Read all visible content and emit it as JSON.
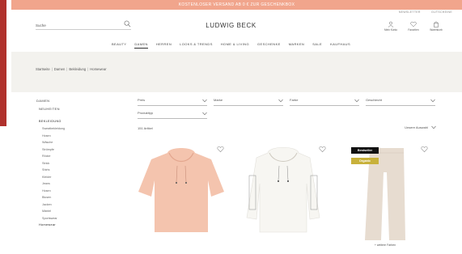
{
  "promo": {
    "text": "KOSTENLOSER VERSAND AB 0 € ZUR GESCHENKBOX"
  },
  "utility": {
    "link1": "NEWSLETTER",
    "link2": "GUTSCHEINE"
  },
  "search": {
    "placeholder": "Suche"
  },
  "header": {
    "logo": "LUDWIG BECK"
  },
  "account": {
    "items": [
      {
        "label": "Mein Konto",
        "icon": "user-icon"
      },
      {
        "label": "Favoriten",
        "icon": "heart-icon"
      },
      {
        "label": "Warenkorb",
        "icon": "bag-icon"
      }
    ]
  },
  "nav": {
    "items": [
      "BEAUTY",
      "DAMEN",
      "HERREN",
      "LOOKS & TRENDS",
      "HOME & LIVING",
      "GESCHENKE",
      "MARKEN",
      "SALE",
      "KAUFHAUS"
    ],
    "active": "DAMEN"
  },
  "breadcrumb": {
    "items": [
      "Startseite",
      "Damen",
      "Bekleidung",
      "Homewear"
    ]
  },
  "sidebar": {
    "head": "DAMEN",
    "sub": "NEUHEITEN",
    "category": "BEKLEIDUNG",
    "items": [
      "Sweatbekleidung",
      "Hosen",
      "Wäsche",
      "Strümpfe",
      "Röcke",
      "Strick",
      "Shirts",
      "Kleider",
      "Jeans",
      "Hosen",
      "Blusen",
      "Jacken",
      "Mäntel",
      "Sportswear",
      "Homewear"
    ]
  },
  "filters": {
    "row1": [
      "Preis",
      "Marke",
      "Farbe",
      "Geschlecht"
    ],
    "row2": [
      "Produkttyp"
    ]
  },
  "results": {
    "count": "151 Artikel",
    "sort": "Unsere Auswahl"
  },
  "products": [
    {
      "color": "#f4c4ae",
      "badges": [],
      "more": ""
    },
    {
      "color": "#f7f6f2",
      "badges": [],
      "more": ""
    },
    {
      "color": "#e7dcd0",
      "badges": [
        "Bestseller",
        "Organic"
      ],
      "more": "+ weitere Farben"
    }
  ],
  "colors": {
    "promo": "#f1a58c",
    "accent_strip": "#b0312c",
    "band": "#f3f2ee"
  }
}
